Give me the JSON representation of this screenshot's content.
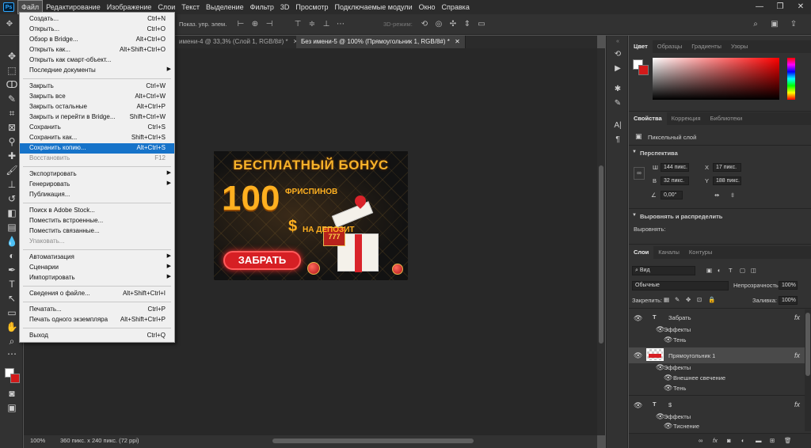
{
  "menubar": {
    "logo": "Ps",
    "items": [
      "Файл",
      "Редактирование",
      "Изображение",
      "Слои",
      "Текст",
      "Выделение",
      "Фильтр",
      "3D",
      "Просмотр",
      "Подключаемые модули",
      "Окно",
      "Справка"
    ],
    "active_index": 0
  },
  "optionsbar": {
    "show_transform": "Показ. упр. элем.",
    "mode_3d": "3D-режим:"
  },
  "window_controls": {
    "minimize": "—",
    "maximize": "❐",
    "close": "✕"
  },
  "tabs": [
    {
      "label": "имени-4 @ 33,3% (Слой 1, RGB/8#) *",
      "close": "✕"
    },
    {
      "label": "Без имени-5 @ 100% (Прямоугольник 1, RGB/8#) *",
      "close": "✕"
    }
  ],
  "artwork": {
    "title": "БЕСПЛАТНЫЙ БОНУС",
    "big_number": "100",
    "spins": "ФРИСПИНОВ",
    "dollar": "$",
    "deposit": "НА ДЕПОЗИТ",
    "button": "ЗАБРАТЬ"
  },
  "status": {
    "zoom": "100%",
    "info": "360 пикс. x 240 пикс. (72 ppi)"
  },
  "color_panel": {
    "tabs": [
      "Цвет",
      "Образцы",
      "Градиенты",
      "Узоры"
    ],
    "accent_color": "#e01e1e"
  },
  "properties_panel": {
    "tabs": [
      "Свойства",
      "Коррекция",
      "Библиотеки"
    ],
    "layer_type": "Пиксельный слой",
    "perspective_title": "Перспектива",
    "w_label": "Ш",
    "w_value": "144 пикс.",
    "x_label": "X",
    "x_value": "17 пикс.",
    "h_label": "В",
    "h_value": "32 пикс.",
    "y_label": "Y",
    "y_value": "188 пикс.",
    "angle_value": "0,00°",
    "align_title": "Выровнять и распределить",
    "align_sub": "Выровнять:"
  },
  "layers_panel": {
    "tabs": [
      "Слои",
      "Каналы",
      "Контуры"
    ],
    "filter_label": "Вид",
    "blend_mode": "Обычные",
    "opacity_label": "Непрозрачность:",
    "opacity_value": "100%",
    "lock_label": "Закрепить:",
    "fill_label": "Заливка:",
    "fill_value": "100%",
    "layers": [
      {
        "type": "T",
        "name": "Забрать",
        "effects_label": "Эффекты",
        "effects": [
          "Тень"
        ]
      },
      {
        "type": "raster",
        "name": "Прямоугольник 1",
        "effects_label": "Эффекты",
        "effects": [
          "Внешнее свечение",
          "Тень"
        ]
      },
      {
        "type": "T",
        "name": "$",
        "effects_label": "Эффекты",
        "effects": [
          "Тиснение"
        ]
      }
    ]
  },
  "file_menu": {
    "items": [
      {
        "label": "Создать...",
        "shortcut": "Ctrl+N"
      },
      {
        "label": "Открыть...",
        "shortcut": "Ctrl+O"
      },
      {
        "label": "Обзор в Bridge...",
        "shortcut": "Alt+Ctrl+O"
      },
      {
        "label": "Открыть как...",
        "shortcut": "Alt+Shift+Ctrl+O"
      },
      {
        "label": "Открыть как смарт-объект...",
        "shortcut": ""
      },
      {
        "label": "Последние документы",
        "shortcut": "",
        "submenu": true
      },
      {
        "sep": true
      },
      {
        "label": "Закрыть",
        "shortcut": "Ctrl+W"
      },
      {
        "label": "Закрыть все",
        "shortcut": "Alt+Ctrl+W"
      },
      {
        "label": "Закрыть остальные",
        "shortcut": "Alt+Ctrl+P"
      },
      {
        "label": "Закрыть и перейти в Bridge...",
        "shortcut": "Shift+Ctrl+W"
      },
      {
        "label": "Сохранить",
        "shortcut": "Ctrl+S"
      },
      {
        "label": "Сохранить как...",
        "shortcut": "Shift+Ctrl+S"
      },
      {
        "label": "Сохранить копию...",
        "shortcut": "Alt+Ctrl+S",
        "highlight": true
      },
      {
        "label": "Восстановить",
        "shortcut": "F12",
        "disabled": true
      },
      {
        "sep": true
      },
      {
        "label": "Экспортировать",
        "shortcut": "",
        "submenu": true
      },
      {
        "label": "Генерировать",
        "shortcut": "",
        "submenu": true
      },
      {
        "label": "Публикация...",
        "shortcut": ""
      },
      {
        "sep": true
      },
      {
        "label": "Поиск в Adobe Stock...",
        "shortcut": ""
      },
      {
        "label": "Поместить встроенные...",
        "shortcut": ""
      },
      {
        "label": "Поместить связанные...",
        "shortcut": ""
      },
      {
        "label": "Упаковать...",
        "shortcut": "",
        "disabled": true
      },
      {
        "sep": true
      },
      {
        "label": "Автоматизация",
        "shortcut": "",
        "submenu": true
      },
      {
        "label": "Сценарии",
        "shortcut": "",
        "submenu": true
      },
      {
        "label": "Импортировать",
        "shortcut": "",
        "submenu": true
      },
      {
        "sep": true
      },
      {
        "label": "Сведения о файле...",
        "shortcut": "Alt+Shift+Ctrl+I"
      },
      {
        "sep": true
      },
      {
        "label": "Печатать...",
        "shortcut": "Ctrl+P"
      },
      {
        "label": "Печать одного экземпляра",
        "shortcut": "Alt+Shift+Ctrl+P"
      },
      {
        "sep": true
      },
      {
        "label": "Выход",
        "shortcut": "Ctrl+Q"
      }
    ]
  }
}
